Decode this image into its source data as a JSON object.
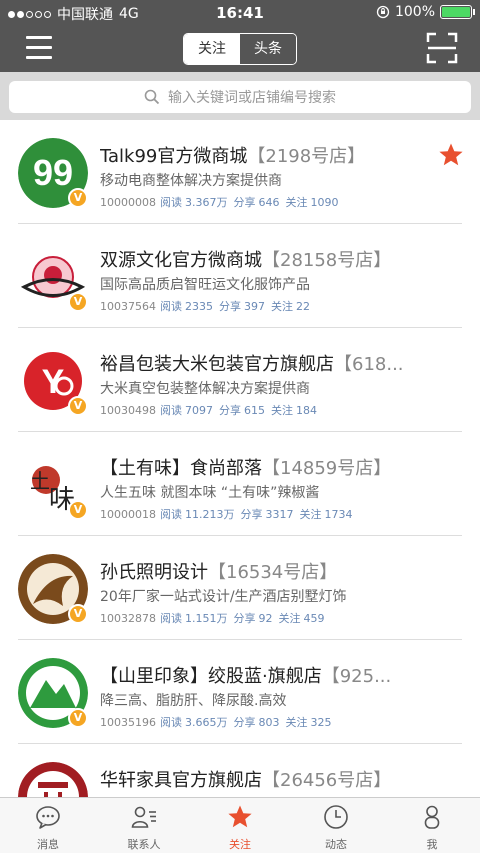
{
  "status_bar": {
    "carrier": "中国联通",
    "network": "4G",
    "time": "16:41",
    "battery_text": "100%",
    "battery_level": 1.0
  },
  "nav": {
    "segments": [
      "关注",
      "头条"
    ],
    "active_segment": 0
  },
  "search": {
    "placeholder": "输入关键词或店铺编号搜索"
  },
  "stores": [
    {
      "name": "Talk99官方微商城",
      "store_no": "【2198号店】",
      "desc": "移动电商整体解决方案提供商",
      "id": "10000008",
      "read_label": "阅读",
      "read": "3.367万",
      "share_label": "分享",
      "share": "646",
      "follow_label": "关注",
      "follow": "1090",
      "starred": true,
      "logo": "talk99-logo"
    },
    {
      "name": "双源文化官方微商城",
      "store_no": "【28158号店】",
      "desc": "国际高品质启智旺运文化服饰产品",
      "id": "10037564",
      "read_label": "阅读",
      "read": "2335",
      "share_label": "分享",
      "share": "397",
      "follow_label": "关注",
      "follow": "22",
      "starred": false,
      "logo": "shuangyuan-logo"
    },
    {
      "name": "裕昌包装大米包装官方旗舰店",
      "store_no": "【618...",
      "desc": "大米真空包装整体解决方案提供商",
      "id": "10030498",
      "read_label": "阅读",
      "read": "7097",
      "share_label": "分享",
      "share": "615",
      "follow_label": "关注",
      "follow": "184",
      "starred": false,
      "logo": "yuchang-logo"
    },
    {
      "name": "【土有味】食尚部落",
      "store_no": "【14859号店】",
      "desc": "人生五味 就图本味 “土有味”辣椒酱",
      "id": "10000018",
      "read_label": "阅读",
      "read": "11.213万",
      "share_label": "分享",
      "share": "3317",
      "follow_label": "关注",
      "follow": "1734",
      "starred": false,
      "logo": "tuyouwei-logo"
    },
    {
      "name": "孙氏照明设计",
      "store_no": "【16534号店】",
      "desc": "20年厂家一站式设计/生产酒店别墅灯饰",
      "id": "10032878",
      "read_label": "阅读",
      "read": "1.151万",
      "share_label": "分享",
      "share": "92",
      "follow_label": "关注",
      "follow": "459",
      "starred": false,
      "logo": "sunshi-logo"
    },
    {
      "name": "【山里印象】绞股蓝·旗舰店",
      "store_no": "【925...",
      "desc": "降三高、脂肪肝、降尿酸.高效",
      "id": "10035196",
      "read_label": "阅读",
      "read": "3.665万",
      "share_label": "分享",
      "share": "803",
      "follow_label": "关注",
      "follow": "325",
      "starred": false,
      "logo": "shanli-logo"
    },
    {
      "name": "华轩家具官方旗舰店",
      "store_no": "【26456号店】",
      "desc": "",
      "id": "",
      "read_label": "",
      "read": "",
      "share_label": "",
      "share": "",
      "follow_label": "",
      "follow": "",
      "starred": false,
      "logo": "huaxuan-logo"
    }
  ],
  "badge_letter": "V",
  "tabs": [
    {
      "label": "消息",
      "icon": "message-icon"
    },
    {
      "label": "联系人",
      "icon": "contacts-icon"
    },
    {
      "label": "关注",
      "icon": "star-icon"
    },
    {
      "label": "动态",
      "icon": "clock-icon"
    },
    {
      "label": "我",
      "icon": "person-icon"
    }
  ],
  "active_tab": 2,
  "colors": {
    "accent": "#e8502f",
    "nav_bg": "#555555",
    "link": "#6a89b5",
    "badge": "#f5a623"
  }
}
